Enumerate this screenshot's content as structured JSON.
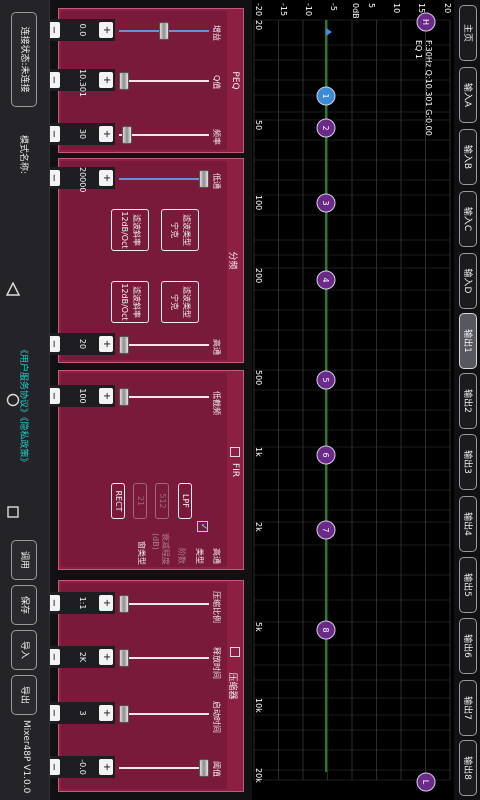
{
  "nav": {
    "tabs": [
      "主页",
      "输入A",
      "输入B",
      "输入C",
      "输入D",
      "输出1",
      "输出2",
      "输出3",
      "输出4",
      "输出5",
      "输出6",
      "输出7",
      "输出8"
    ],
    "active": "输出1"
  },
  "graph": {
    "y_ticks": [
      "20",
      "15",
      "10",
      "5",
      "0dB",
      "-5",
      "-10",
      "-15",
      "-20"
    ],
    "x_ticks": [
      "20",
      "50",
      "100",
      "200",
      "500",
      "1k",
      "2k",
      "5k",
      "10k",
      "20k"
    ],
    "info_line1": "F:30Hz Q:10.301 G:0.00",
    "info_line2": "EQ 1",
    "nodes": [
      "H",
      "1",
      "2",
      "3",
      "4",
      "5",
      "6",
      "7",
      "8",
      "L"
    ]
  },
  "peq": {
    "title": "PEQ",
    "labels": {
      "freq": "频率",
      "q": "Q值",
      "gain": "增益"
    },
    "values": {
      "freq": "30",
      "q": "10.301",
      "gain": "0.0"
    }
  },
  "divider": {
    "title": "分频",
    "hp_label": "高通",
    "lp_label": "低通",
    "hp_value": "20",
    "lp_value": "20000",
    "filter_type_label": "滤波类型",
    "filter_type_value": "宁克",
    "slope_label": "滤波斜率",
    "slope_value": "12dB/Oct"
  },
  "fir": {
    "title": "FIR",
    "hp_label": "高通",
    "type_label": "类型",
    "type_value": "LPF",
    "taps_label": "阶数",
    "taps_value": "512",
    "atten_label": "衰减程度(dB)",
    "atten_value": "21",
    "window_label": "窗类型",
    "window_value": "RECT",
    "low_freq_label": "低截频",
    "low_freq_value": "100"
  },
  "compressor": {
    "title": "压缩器",
    "labels": {
      "threshold": "阈值",
      "attack": "启动时间",
      "release": "释放时间",
      "ratio": "压缩比例"
    },
    "values": {
      "threshold": "-0.0",
      "attack": "3",
      "release": "2K",
      "ratio": "1:1"
    }
  },
  "bottom": {
    "connect_status": "连接状态:未连接",
    "mode_name": "模式名称:",
    "links": "《用户服务协议》《隐私政策》",
    "buttons": [
      "调用",
      "保存",
      "导入",
      "导出"
    ],
    "version": "Mixer48P V1.0.0"
  },
  "sysnav": {
    "icons": [
      "back-icon",
      "home-icon",
      "recents-icon"
    ]
  }
}
